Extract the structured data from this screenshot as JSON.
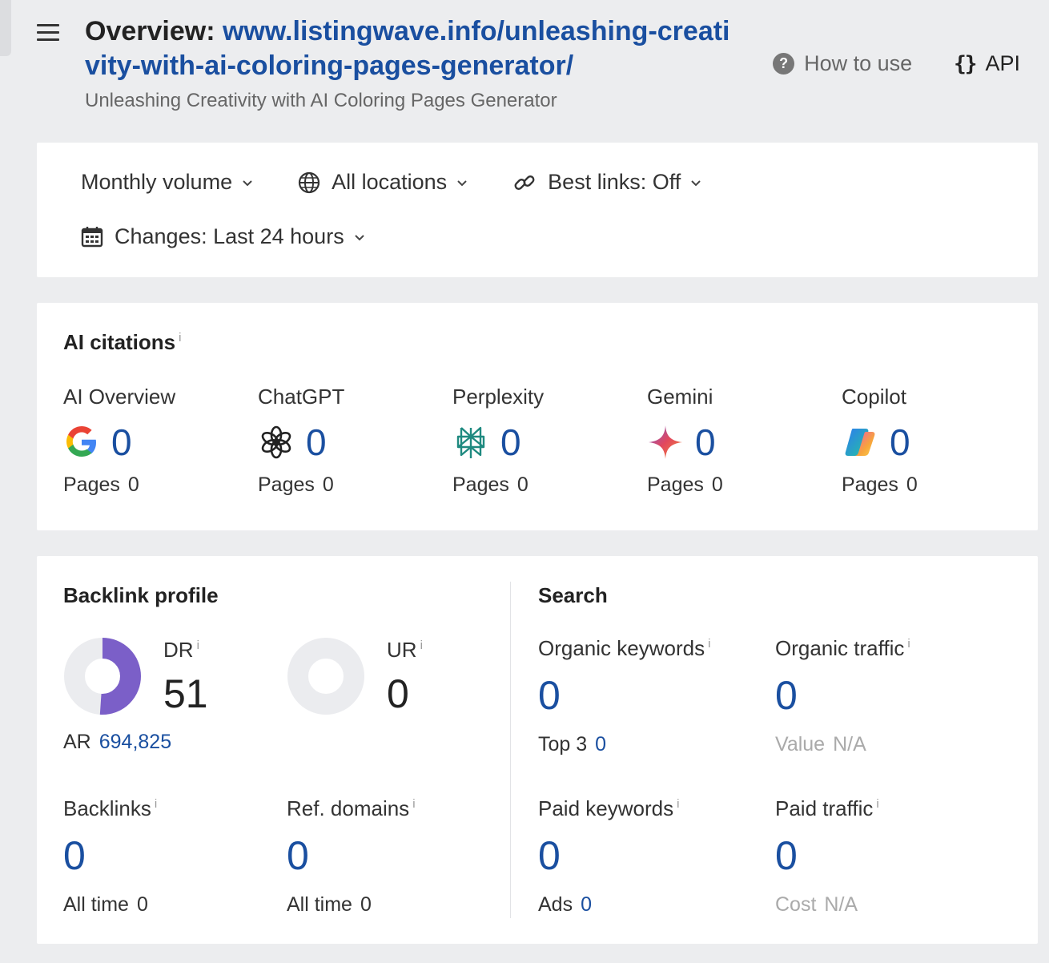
{
  "header": {
    "title_prefix": "Overview:",
    "url": "www.listingwave.info/unleashing-creativity-with-ai-coloring-pages-generator/",
    "subtitle": "Unleashing Creativity with AI Coloring Pages Generator"
  },
  "actions": {
    "how_to_use": "How to use",
    "api": "API"
  },
  "filters": {
    "volume": "Monthly volume",
    "locations": "All locations",
    "best_links": "Best links: Off",
    "changes": "Changes: Last 24 hours"
  },
  "ai_citations": {
    "title": "AI citations",
    "info": "i",
    "pages_label": "Pages",
    "items": [
      {
        "name": "AI Overview",
        "icon": "google-icon",
        "value": "0",
        "pages": "0"
      },
      {
        "name": "ChatGPT",
        "icon": "chatgpt-icon",
        "value": "0",
        "pages": "0"
      },
      {
        "name": "Perplexity",
        "icon": "perplexity-icon",
        "value": "0",
        "pages": "0"
      },
      {
        "name": "Gemini",
        "icon": "gemini-icon",
        "value": "0",
        "pages": "0"
      },
      {
        "name": "Copilot",
        "icon": "copilot-icon",
        "value": "0",
        "pages": "0"
      }
    ]
  },
  "backlink_profile": {
    "title": "Backlink profile",
    "dr_label": "DR",
    "dr_value": "51",
    "dr_fraction": 0.51,
    "ur_label": "UR",
    "ur_value": "0",
    "ur_fraction": 0,
    "ar_label": "AR",
    "ar_value": "694,825",
    "backlinks_label": "Backlinks",
    "backlinks_value": "0",
    "backlinks_sub_label": "All time",
    "backlinks_sub_value": "0",
    "ref_domains_label": "Ref. domains",
    "ref_domains_value": "0",
    "ref_domains_sub_label": "All time",
    "ref_domains_sub_value": "0"
  },
  "search": {
    "title": "Search",
    "organic_keywords_label": "Organic keywords",
    "organic_keywords_value": "0",
    "top3_label": "Top 3",
    "top3_value": "0",
    "organic_traffic_label": "Organic traffic",
    "organic_traffic_value": "0",
    "value_label": "Value",
    "value_value": "N/A",
    "paid_keywords_label": "Paid keywords",
    "paid_keywords_value": "0",
    "ads_label": "Ads",
    "ads_value": "0",
    "paid_traffic_label": "Paid traffic",
    "paid_traffic_value": "0",
    "cost_label": "Cost",
    "cost_value": "N/A"
  },
  "colors": {
    "accent": "#1a4fa0",
    "donut_fill": "#7b5fc8",
    "donut_track": "#ebecef"
  }
}
